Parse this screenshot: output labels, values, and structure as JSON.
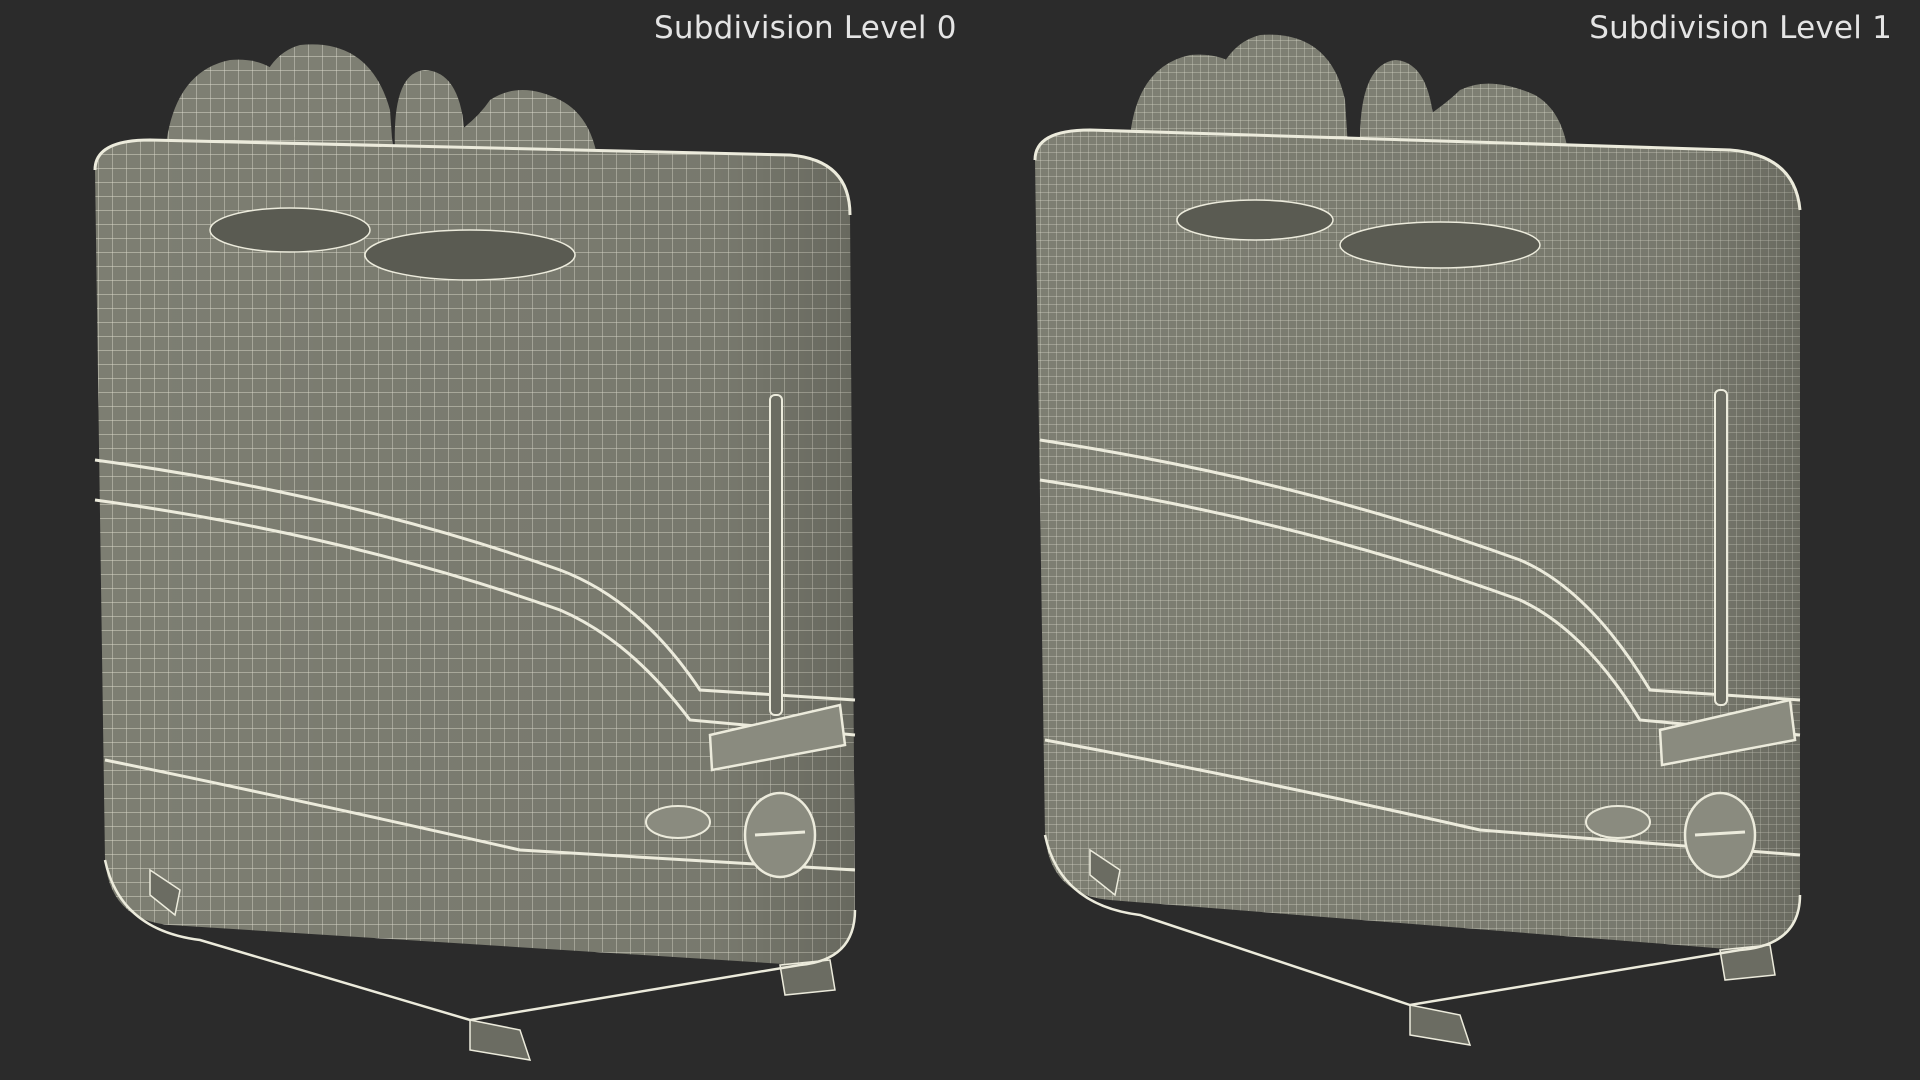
{
  "labels": {
    "left": "Subdivision Level 0",
    "right": "Subdivision Level 1"
  },
  "colors": {
    "background": "#2b2b2b",
    "model_fill": "#7e7f73",
    "wire": "#ecebdc"
  }
}
